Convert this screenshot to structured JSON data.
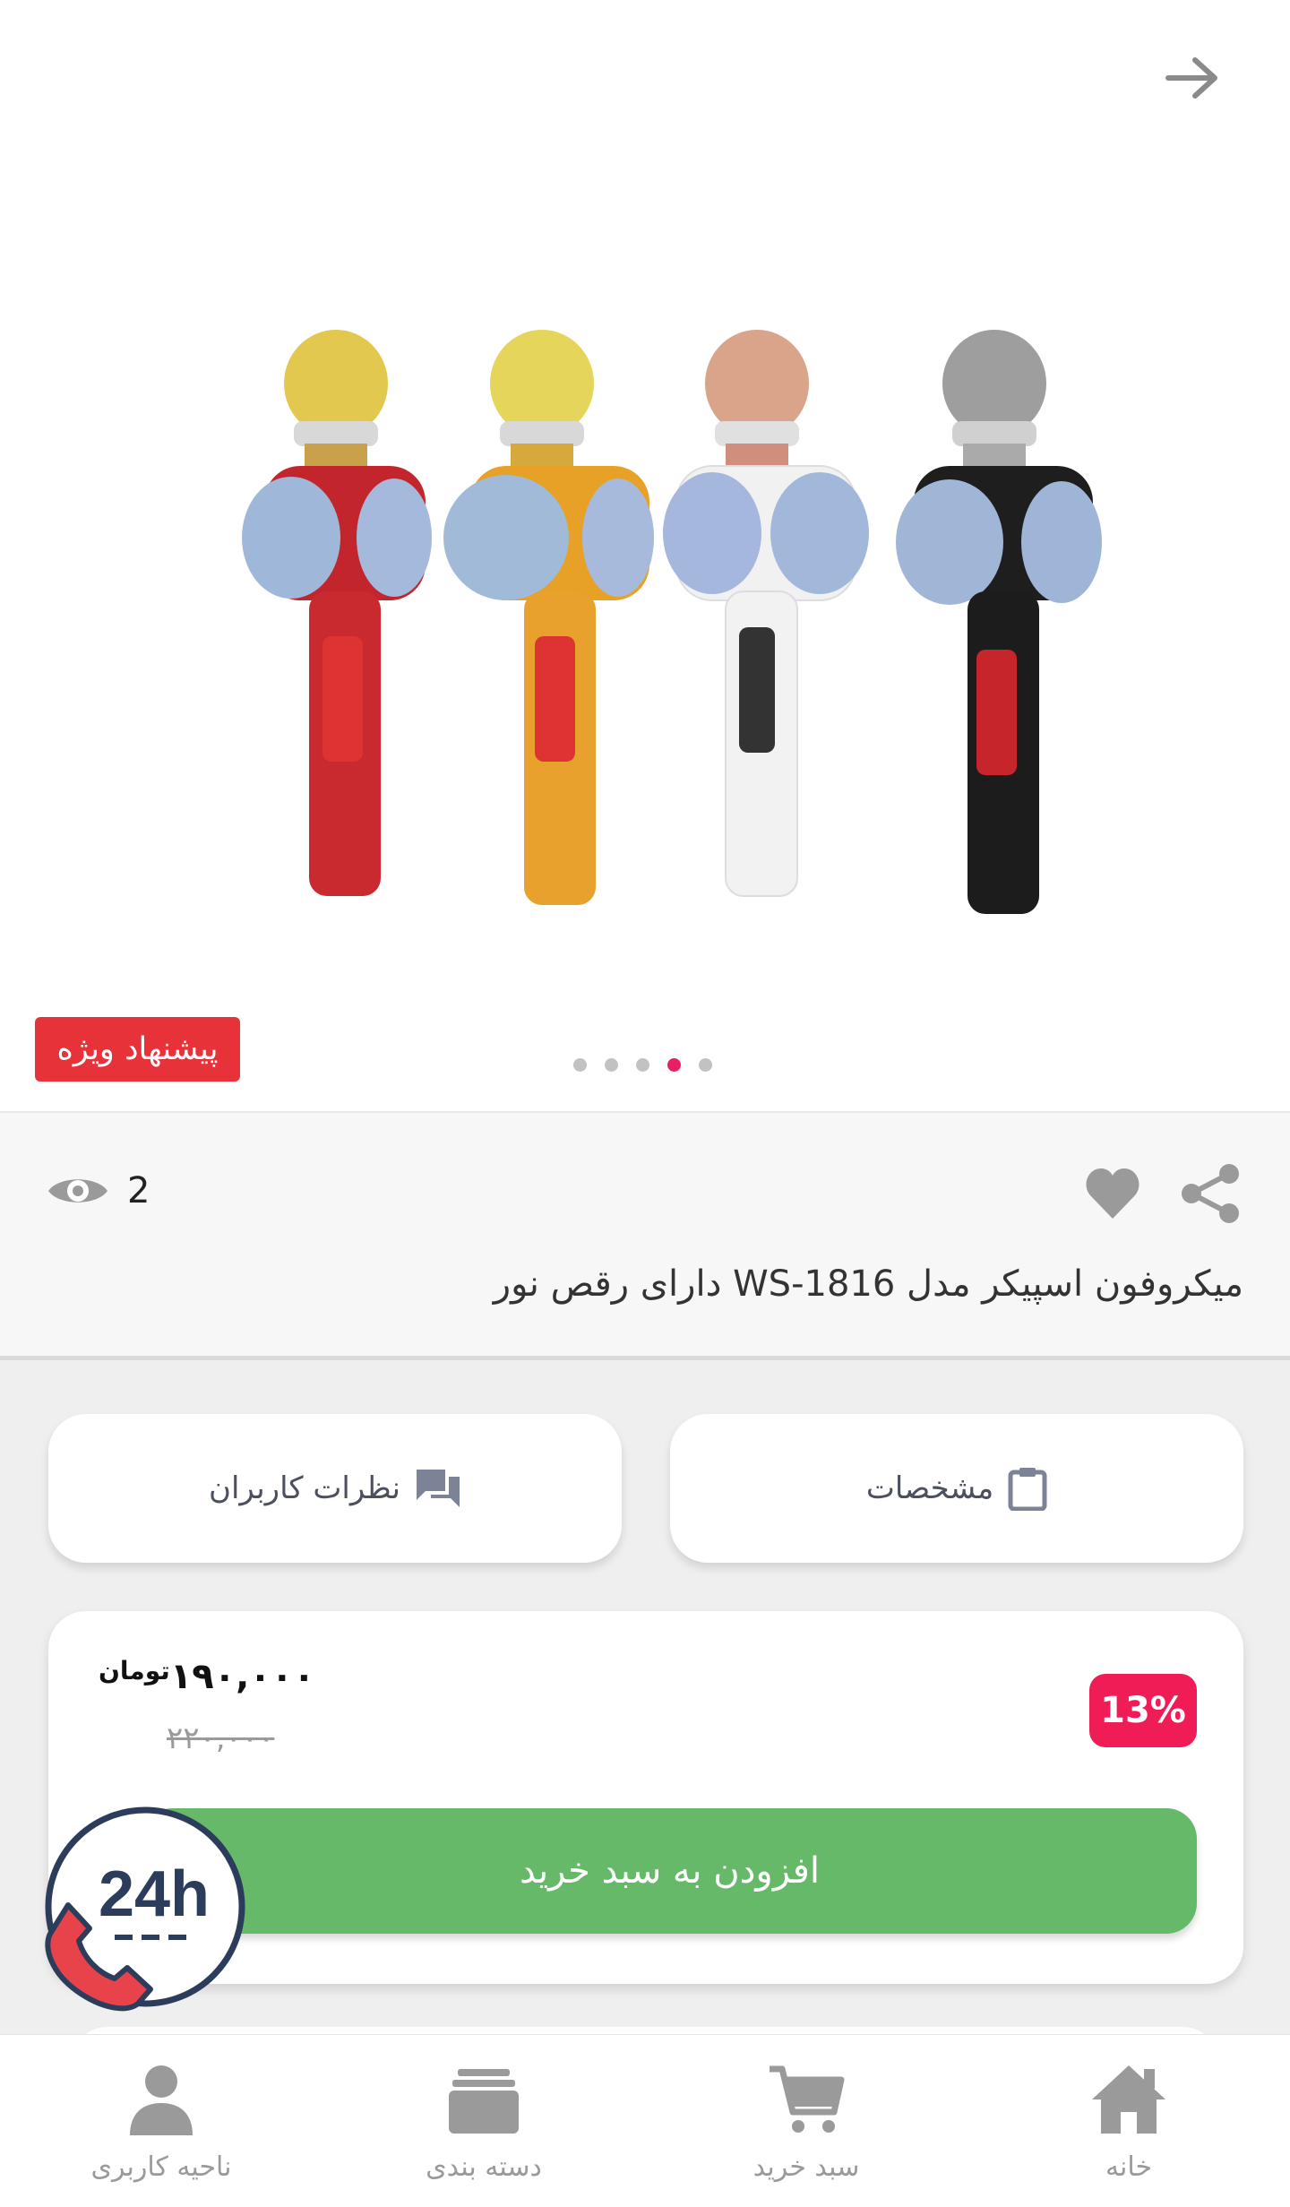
{
  "header": {
    "back_icon": "arrow-right-icon"
  },
  "gallery": {
    "badge": "پیشنهاد ویژه",
    "dots_count": 5,
    "active_dot_index": 3,
    "image_alt": "microphones-product-image"
  },
  "product": {
    "views": "2",
    "title": "میکروفون اسپیکر مدل WS-1816 دارای رقص نور"
  },
  "tabs": {
    "specs_label": "مشخصات",
    "reviews_label": "نظرات کاربران"
  },
  "price": {
    "discount": "13%",
    "current": "۱۹۰,۰۰۰",
    "currency": "تومان",
    "old": "۲۲۰,۰۰۰",
    "add_to_cart": "افزودن به سبد خرید"
  },
  "support": {
    "label": "24h"
  },
  "bottom_nav": {
    "items": [
      {
        "label": "خانه",
        "icon": "home-icon"
      },
      {
        "label": "سبد خرید",
        "icon": "cart-icon"
      },
      {
        "label": "دسته بندی",
        "icon": "category-icon"
      },
      {
        "label": "ناحیه کاربری",
        "icon": "user-icon"
      }
    ]
  },
  "colors": {
    "accent": "#e91e63",
    "badge_red": "#e8323a",
    "discount_pink": "#f01c56",
    "cart_green": "#67b96a",
    "icon_gray": "#9a9a9a"
  }
}
